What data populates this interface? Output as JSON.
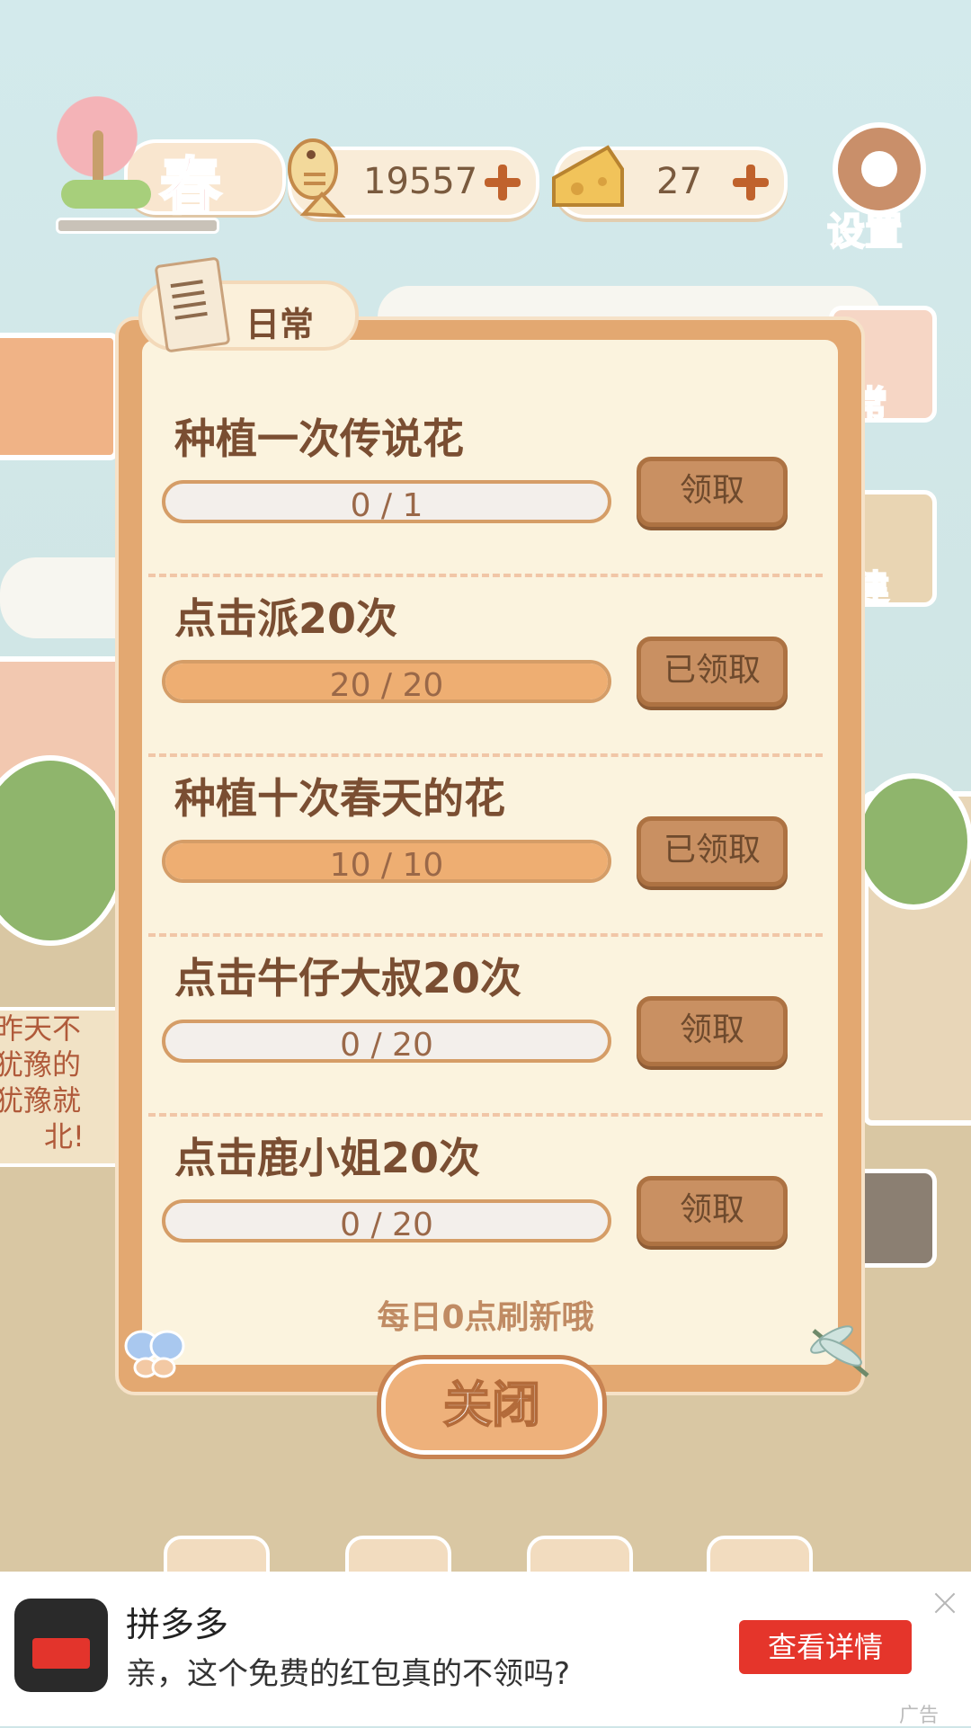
{
  "hud": {
    "season_label": "春",
    "fish_count": "19557",
    "cheese_count": "27",
    "settings_label": "设置"
  },
  "side_buttons": {
    "daily_partial": "日常",
    "build_partial": "建"
  },
  "notice_sign": [
    "昨天不",
    "犹豫的",
    "犹豫就",
    "北!"
  ],
  "dialog": {
    "tab_label": "日常",
    "tasks": [
      {
        "title": "种植一次传说花",
        "progress": "0 / 1",
        "ratio": 0,
        "button": "领取"
      },
      {
        "title": "点击派20次",
        "progress": "20 / 20",
        "ratio": 1,
        "button": "已领取"
      },
      {
        "title": "种植十次春天的花",
        "progress": "10 / 10",
        "ratio": 1,
        "button": "已领取"
      },
      {
        "title": "点击牛仔大叔20次",
        "progress": "0 / 20",
        "ratio": 0,
        "button": "领取"
      },
      {
        "title": "点击鹿小姐20次",
        "progress": "0 / 20",
        "ratio": 0,
        "button": "领取"
      }
    ],
    "refresh_note": "每日0点刷新哦",
    "close_label": "关闭"
  },
  "ad": {
    "app_name": "拼多多",
    "description": "亲，这个免费的红包真的不领吗?",
    "cta": "查看详情",
    "tag": "广告"
  },
  "colors": {
    "accent": "#e3a871",
    "button": "#c99062",
    "ad_cta": "#e5352b"
  }
}
